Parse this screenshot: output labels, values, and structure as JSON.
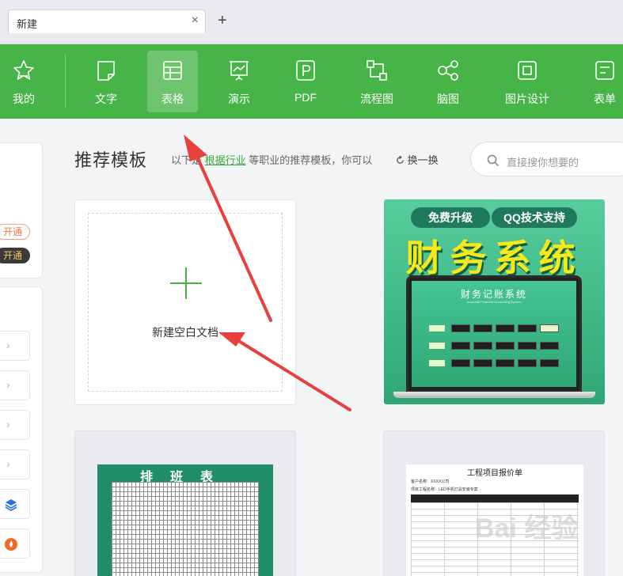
{
  "tab": {
    "title": "新建",
    "close": "×",
    "add": "+"
  },
  "toolbar": {
    "items": [
      {
        "label": "我的",
        "icon": "star-icon"
      },
      {
        "label": "文字",
        "icon": "document-icon"
      },
      {
        "label": "表格",
        "icon": "table-icon",
        "active": true
      },
      {
        "label": "演示",
        "icon": "presentation-icon"
      },
      {
        "label": "PDF",
        "icon": "pdf-icon"
      },
      {
        "label": "流程图",
        "icon": "flowchart-icon"
      },
      {
        "label": "脑图",
        "icon": "mindmap-icon"
      },
      {
        "label": "图片设计",
        "icon": "image-design-icon"
      },
      {
        "label": "表单",
        "icon": "form-icon"
      }
    ],
    "accent": "#46b447"
  },
  "left": {
    "pill_open_1": "开通",
    "pill_open_2": "开通"
  },
  "main": {
    "section_title": "推荐模板",
    "hint_prefix": "以下是",
    "hint_link": "根据行业",
    "hint_suffix": "等职业的推荐模板，你可以",
    "refresh_label": "换一换",
    "search_placeholder": "直接搜你想要的"
  },
  "blank": {
    "label": "新建空白文档"
  },
  "templates": {
    "finance": {
      "badge_left": "免费升级",
      "badge_right": "QQ技术支持",
      "title": "财务系统",
      "screen_title": "财务记账系统",
      "screen_subtitle": "Universal Financial Accounting System"
    },
    "schedule": {
      "title": "排班表"
    },
    "quote": {
      "title": "工程项目报价单",
      "line1": "客户名称：XXXX公司",
      "line2": "项目工程名称：LED手机灯具安装专案"
    }
  },
  "watermark": "Bai 经验"
}
